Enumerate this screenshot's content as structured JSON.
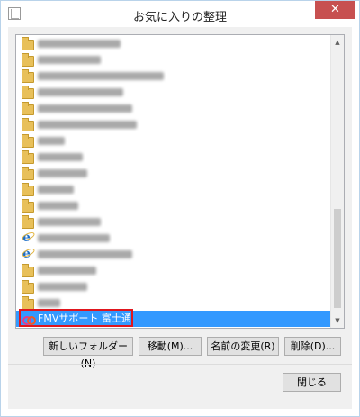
{
  "window": {
    "title": "お気に入りの整理",
    "close_glyph": "✕"
  },
  "favorites_list": {
    "items": [
      {
        "type": "folder",
        "blurred": true
      },
      {
        "type": "folder",
        "blurred": true
      },
      {
        "type": "folder",
        "blurred": true
      },
      {
        "type": "folder",
        "blurred": true
      },
      {
        "type": "folder",
        "blurred": true
      },
      {
        "type": "folder",
        "blurred": true
      },
      {
        "type": "folder",
        "blurred": true
      },
      {
        "type": "folder",
        "blurred": true
      },
      {
        "type": "folder",
        "blurred": true
      },
      {
        "type": "folder",
        "blurred": true
      },
      {
        "type": "folder",
        "blurred": true
      },
      {
        "type": "folder",
        "blurred": true
      },
      {
        "type": "link",
        "blurred": true
      },
      {
        "type": "link",
        "blurred": true
      },
      {
        "type": "folder",
        "blurred": true
      },
      {
        "type": "folder",
        "blurred": true
      },
      {
        "type": "folder",
        "blurred": true
      }
    ],
    "selected_item": {
      "label": "FMVサポート 富士通",
      "icon": "fmv-logo-icon"
    }
  },
  "buttons": {
    "new_folder": "新しいフォルダー(N)",
    "move": "移動(M)...",
    "rename": "名前の変更(R)",
    "delete": "削除(D)...",
    "close": "閉じる"
  },
  "colors": {
    "selection": "#3399ff",
    "highlight_border": "#e0161e",
    "close_button": "#c75050"
  }
}
